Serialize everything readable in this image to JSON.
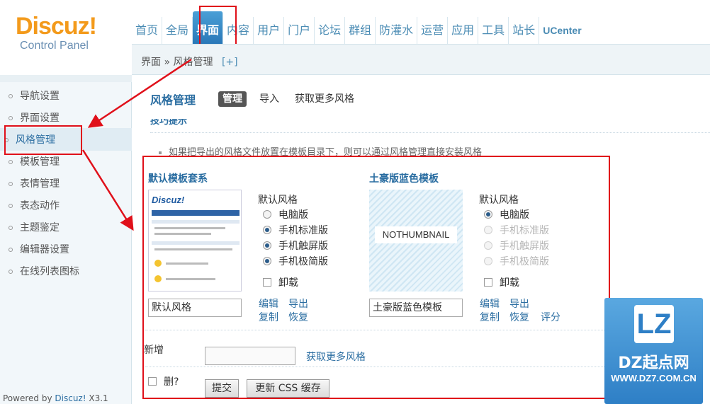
{
  "header": {
    "logo_text": "Discuz!",
    "logo_sub": "Control Panel",
    "nav": [
      "首页",
      "全局",
      "界面",
      "内容",
      "用户",
      "门户",
      "论坛",
      "群组",
      "防灌水",
      "运营",
      "应用",
      "工具",
      "站长",
      "UCenter"
    ],
    "active_nav": "界面"
  },
  "breadcrumb": {
    "section": "界面",
    "separator": "»",
    "page": "风格管理",
    "add": "[+]"
  },
  "sidebar": {
    "items": [
      "导航设置",
      "界面设置",
      "风格管理",
      "模板管理",
      "表情管理",
      "表态动作",
      "主题鉴定",
      "编辑器设置",
      "在线列表图标"
    ],
    "active": "风格管理",
    "powered_prefix": "Powered by",
    "powered_link": "Discuz!",
    "powered_version": "X3.1"
  },
  "main": {
    "title": "风格管理",
    "tabs": [
      "管理",
      "导入",
      "获取更多风格"
    ],
    "tips_heading": "技巧提示",
    "tip": "如果把导出的风格文件放置在模板目录下，则可以通过风格管理直接安装风格",
    "styles": [
      {
        "title": "默认模板套系",
        "thumb_logo": "Discuz!",
        "options_head": "默认风格",
        "options": [
          "电脑版",
          "手机标准版",
          "手机触屏版",
          "手机极简版"
        ],
        "uninstall": "卸载",
        "name": "默认风格",
        "actions": [
          "编辑",
          "导出",
          "复制",
          "恢复"
        ]
      },
      {
        "title": "土豪版蓝色模板",
        "nothumb": "NOTHUMBNAIL",
        "options_head": "默认风格",
        "options": [
          "电脑版",
          "手机标准版",
          "手机触屏版",
          "手机极简版"
        ],
        "uninstall": "卸载",
        "name": "土豪版蓝色模板",
        "actions": [
          "编辑",
          "导出",
          "复制",
          "恢复",
          "评分"
        ]
      }
    ],
    "new_label": "新增",
    "get_more": "获取更多风格",
    "delete_label": "删?",
    "submit": "提交",
    "update_css": "更新 CSS 缓存"
  },
  "watermark": {
    "logo": "LZ",
    "main": "DZ起点网",
    "url": "WWW.DZ7.COM.CN"
  },
  "colors": {
    "accent": "#2a6da1",
    "highlight": "#e0101a",
    "brand": "#f39a1b"
  }
}
